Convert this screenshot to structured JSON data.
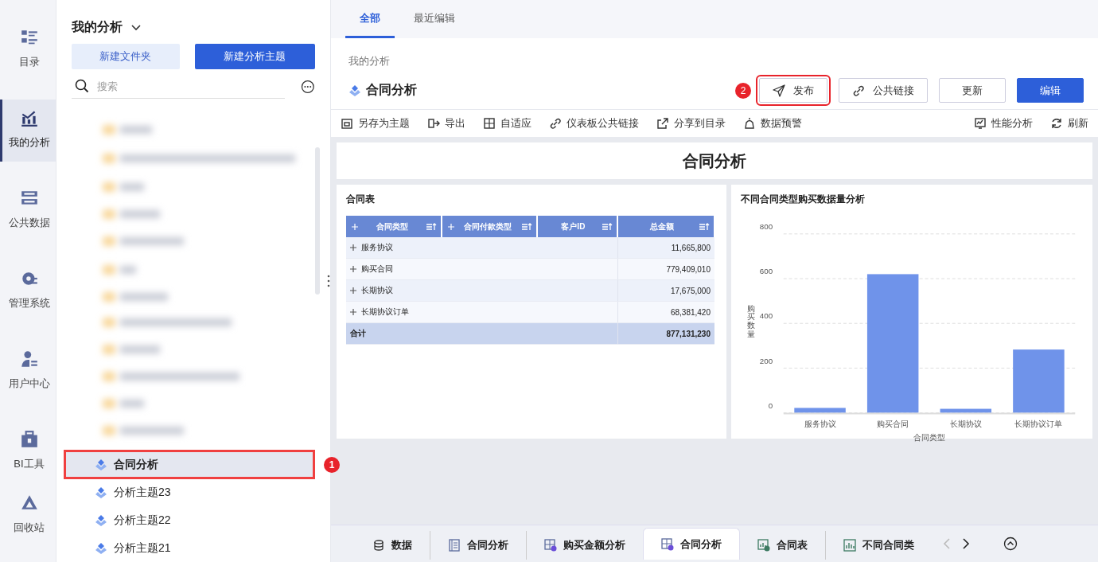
{
  "nav": {
    "items": [
      {
        "label": "目录",
        "selected": false
      },
      {
        "label": "我的分析",
        "selected": true
      },
      {
        "label": "公共数据",
        "selected": false
      },
      {
        "label": "管理系统",
        "selected": false
      },
      {
        "label": "用户中心",
        "selected": false
      },
      {
        "label": "BI工具",
        "selected": false
      },
      {
        "label": "回收站",
        "selected": false
      }
    ]
  },
  "panel": {
    "title": "我的分析",
    "buttons": [
      {
        "label": "新建文件夹",
        "kind": "secondary"
      },
      {
        "label": "新建分析主题",
        "kind": "primary"
      }
    ],
    "search": {
      "placeholder": "搜索"
    },
    "items": [
      {
        "label": "合同分析",
        "selected": true,
        "callout": "1"
      },
      {
        "label": "分析主题23",
        "selected": false
      },
      {
        "label": "分析主题22",
        "selected": false
      },
      {
        "label": "分析主题21",
        "selected": false
      }
    ]
  },
  "main": {
    "tabs": [
      {
        "label": "全部",
        "selected": true
      },
      {
        "label": "最近编辑",
        "selected": false
      }
    ],
    "breadcrumb": "我的分析",
    "title": "合同分析",
    "actions": [
      {
        "label": "发布",
        "kind": "outline",
        "callout": "2"
      },
      {
        "label": "公共链接",
        "kind": "outline"
      },
      {
        "label": "更新",
        "kind": "outline"
      },
      {
        "label": "编辑",
        "kind": "primary"
      }
    ],
    "toolbar_left": [
      "另存为主题",
      "导出",
      "自适应",
      "仪表板公共链接",
      "分享到目录",
      "数据预警"
    ],
    "toolbar_right": [
      "性能分析",
      "刷新"
    ],
    "dashboard": {
      "title": "合同分析",
      "table": {
        "title": "合同表",
        "columns": [
          "合同类型",
          "合同付款类型",
          "客户ID",
          "总金额"
        ],
        "rows": [
          {
            "type": "服务协议",
            "amount": "11,665,800"
          },
          {
            "type": "购买合同",
            "amount": "779,409,010"
          },
          {
            "type": "长期协议",
            "amount": "17,675,000"
          },
          {
            "type": "长期协议订单",
            "amount": "68,381,420"
          }
        ],
        "total": {
          "label": "合计",
          "amount": "877,131,230"
        }
      },
      "chart": {
        "title": "不同合同类型购买数据量分析",
        "chart_data": {
          "type": "bar",
          "xlabel": "合同类型",
          "ylabel": "购买数量",
          "categories": [
            "服务协议",
            "购买合同",
            "长期协议",
            "长期协议订单"
          ],
          "series": [
            {
              "color": "#6f93ea",
              "values": [
                22,
                620,
                18,
                283
              ]
            }
          ],
          "grid": true,
          "ylim": [
            0,
            800
          ],
          "yticks": [
            0,
            200,
            400,
            600,
            800
          ]
        }
      }
    },
    "bottom_tabs": [
      {
        "label": "数据",
        "selected": false
      },
      {
        "label": "合同分析",
        "selected": false
      },
      {
        "label": "购买金额分析",
        "selected": false
      },
      {
        "label": "合同分析",
        "selected": true
      },
      {
        "label": "合同表",
        "selected": false
      },
      {
        "label": "不同合同类",
        "selected": false
      }
    ]
  }
}
